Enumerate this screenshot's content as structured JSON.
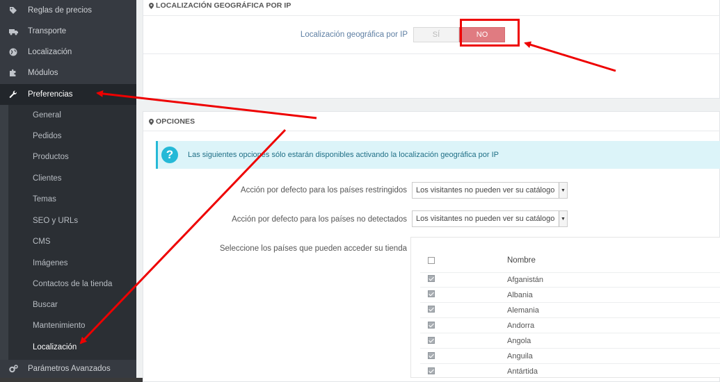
{
  "sidebar": {
    "items": [
      {
        "label": "Reglas de precios",
        "icon": "tag-icon"
      },
      {
        "label": "Transporte",
        "icon": "truck-icon"
      },
      {
        "label": "Localización",
        "icon": "globe-icon"
      },
      {
        "label": "Módulos",
        "icon": "puzzle-icon"
      },
      {
        "label": "Preferencias",
        "icon": "wrench-icon",
        "active": true
      }
    ],
    "submenu": [
      "General",
      "Pedidos",
      "Productos",
      "Clientes",
      "Temas",
      "SEO y URLs",
      "CMS",
      "Imágenes",
      "Contactos de la tienda",
      "Buscar",
      "Mantenimiento",
      "Localización"
    ],
    "bottom_item": {
      "label": "Parámetros Avanzados",
      "icon": "cogs-icon"
    }
  },
  "geo_panel": {
    "title": "LOCALIZACIÓN GEOGRÁFICA POR IP",
    "field_label": "Localización geográfica por IP",
    "switch": {
      "yes": "SÍ",
      "no": "NO",
      "selected": "NO"
    }
  },
  "options_panel": {
    "title": "OPCIONES",
    "info": "Las siguientes opciones sólo estarán disponibles activando la localización geográfica por IP",
    "restricted_label": "Acción por defecto para los países restringidos",
    "restricted_value": "Los visitantes no pueden ver su catálogo",
    "undetected_label": "Acción por defecto para los países no detectados",
    "undetected_value": "Los visitantes no pueden ver su catálogo",
    "countries_label": "Seleccione los países que pueden acceder su tienda",
    "table_header": "Nombre",
    "countries": [
      "Afganistán",
      "Albania",
      "Alemania",
      "Andorra",
      "Angola",
      "Anguila",
      "Antártida"
    ]
  },
  "colors": {
    "sidebar": "#363a41",
    "switch_no": "#e07b81",
    "info_bg": "#dcf4f9",
    "annotation": "#ee0000"
  }
}
